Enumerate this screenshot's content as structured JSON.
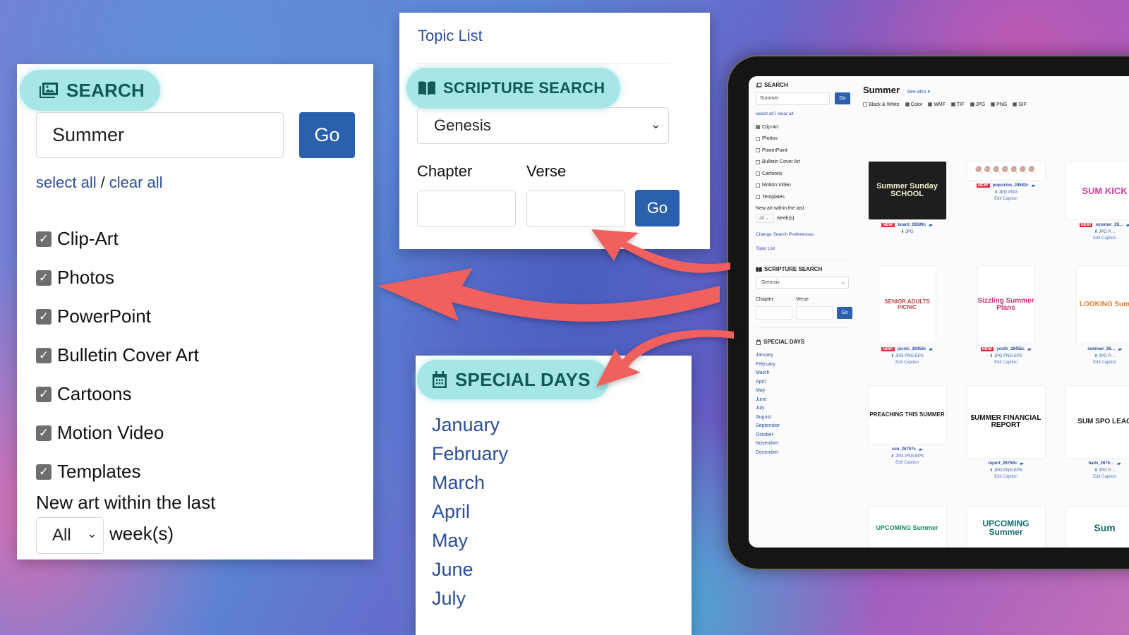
{
  "search_panel": {
    "heading": "SEARCH",
    "heading_icon": "images-icon",
    "query_value": "Summer",
    "go_label": "Go",
    "select_all": "select all",
    "separator": "/",
    "clear_all": "clear all",
    "categories": [
      {
        "label": "Clip-Art",
        "checked": true
      },
      {
        "label": "Photos",
        "checked": true
      },
      {
        "label": "PowerPoint",
        "checked": true
      },
      {
        "label": "Bulletin Cover Art",
        "checked": true
      },
      {
        "label": "Cartoons",
        "checked": true
      },
      {
        "label": "Motion Video",
        "checked": true
      },
      {
        "label": "Templates",
        "checked": true
      }
    ],
    "new_art_label": "New art within the last",
    "weeks_value": "All",
    "weeks_label": "week(s)"
  },
  "scripture_panel": {
    "topic_list": "Topic List",
    "heading": "SCRIPTURE SEARCH",
    "heading_icon": "book-open-icon",
    "book_value": "Genesis",
    "chapter_label": "Chapter",
    "verse_label": "Verse",
    "chapter_value": "",
    "verse_value": "",
    "go_label": "Go"
  },
  "special_days_panel": {
    "heading": "SPECIAL DAYS",
    "heading_icon": "calendar-icon",
    "months": [
      "January",
      "February",
      "March",
      "April",
      "May",
      "June",
      "July"
    ]
  },
  "tablet": {
    "sidebar": {
      "search_heading": "SEARCH",
      "query_value": "Summer",
      "go_label": "Go",
      "select_all": "select all",
      "clear_all": "clear all",
      "categories": [
        {
          "label": "Clip-Art",
          "checked": true
        },
        {
          "label": "Photos",
          "checked": false
        },
        {
          "label": "PowerPoint",
          "checked": false
        },
        {
          "label": "Bulletin Cover Art",
          "checked": false
        },
        {
          "label": "Cartoons",
          "checked": false
        },
        {
          "label": "Motion Video",
          "checked": false
        },
        {
          "label": "Templates",
          "checked": false
        }
      ],
      "new_art_label": "New art within the last",
      "weeks_value": "All",
      "weeks_label": "week(s)",
      "change_prefs": "Change Search Preferences",
      "topic_list": "Topic List",
      "scripture_heading": "SCRIPTURE SEARCH",
      "book_value": "Genesis",
      "chapter_label": "Chapter",
      "verse_label": "Verse",
      "scripture_go": "Go",
      "special_heading": "SPECIAL DAYS",
      "months": [
        "January",
        "February",
        "March",
        "April",
        "May",
        "June",
        "July",
        "August",
        "September",
        "October",
        "November",
        "December"
      ]
    },
    "main": {
      "title": "Summer",
      "see_also": "See also ▾",
      "filters": [
        {
          "label": "Black & White",
          "checked": false
        },
        {
          "label": "Color",
          "checked": true
        },
        {
          "label": "WMF",
          "checked": true
        },
        {
          "label": "TIF",
          "checked": true
        },
        {
          "label": "JPG",
          "checked": true
        },
        {
          "label": "PNG",
          "checked": true
        },
        {
          "label": "GIF",
          "checked": true
        }
      ],
      "new_badge": "NEW!",
      "edit_caption": "Edit Caption",
      "results": [
        {
          "name": "board_28599c",
          "new": true,
          "formats": "JPG",
          "art_text": "Summer Sunday SCHOOL",
          "edit": false
        },
        {
          "name": "popsicles_28582c",
          "new": true,
          "formats": "JPG PNG",
          "art_text": "🍭🍭🍭🍭🍭🍭🍭",
          "edit": true
        },
        {
          "name": "summer_28…",
          "new": true,
          "formats": "JPG P…",
          "art_text": "SUM KICK",
          "edit": true
        },
        {
          "name": "picnic_28456c",
          "new": true,
          "formats": "JPG PNG EPS",
          "art_text": "SENIOR ADULTS PICNIC",
          "edit": true
        },
        {
          "name": "youth_28455c",
          "new": true,
          "formats": "JPG PNG EPS",
          "art_text": "Sizzling Summer Plans",
          "edit": true
        },
        {
          "name": "summer_28…",
          "new": false,
          "formats": "JPG P…",
          "art_text": "LOOKING Sum",
          "edit": true
        },
        {
          "name": "sun_26757c",
          "new": false,
          "formats": "JPG PNG EPS",
          "art_text": "PREACHING THIS SUMMER",
          "edit": true
        },
        {
          "name": "report_26759c",
          "new": false,
          "formats": "JPG PNG EPS",
          "art_text": "$UMMER FINANCIAL REPORT",
          "edit": true
        },
        {
          "name": "balls_2675…",
          "new": false,
          "formats": "JPG P…",
          "art_text": "SUM SPO LEAG",
          "edit": true
        },
        {
          "name": "",
          "new": false,
          "formats": "",
          "art_text": "UPCOMING Summer",
          "edit": false
        },
        {
          "name": "",
          "new": false,
          "formats": "",
          "art_text": "UPCOMING Summer",
          "edit": false
        },
        {
          "name": "",
          "new": false,
          "formats": "",
          "art_text": "Sum",
          "edit": false
        }
      ]
    }
  },
  "colors": {
    "pill_bg": "#a6e6e6",
    "pill_text": "#12585a",
    "button_blue": "#2a60ae",
    "link_blue": "#2a4e9a",
    "arrow_red": "#f0605e",
    "new_badge_red": "#d92b3a"
  }
}
